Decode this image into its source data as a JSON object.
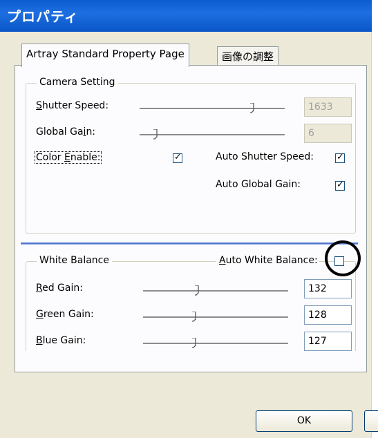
{
  "window": {
    "title": "プロパティ"
  },
  "tabs": [
    {
      "label": "Artray Standard Property Page",
      "active": true
    },
    {
      "label": "画像の調整",
      "active": false
    }
  ],
  "camera_setting": {
    "legend": "Camera Setting",
    "shutter_speed": {
      "label_ul": "S",
      "label_rest": "hutter Speed:",
      "value": "1633",
      "slider_fraction": 0.79
    },
    "global_gain": {
      "label_pre": "Global Ga",
      "label_ul": "i",
      "label_post": "n:",
      "value": "6",
      "slider_fraction": 0.1
    },
    "color_enable": {
      "label_pre": "Color ",
      "label_ul": "E",
      "label_post": "nable:",
      "checked": true
    },
    "auto_shutter_speed": {
      "label": "Auto Shutter Speed:",
      "checked": true
    },
    "auto_global_gain": {
      "label": "Auto Global Gain:",
      "checked": true
    }
  },
  "white_balance": {
    "legend": "White Balance",
    "auto": {
      "label_ul": "A",
      "label_rest": "uto White Balance:",
      "checked": false
    },
    "red_gain": {
      "label_ul": "R",
      "label_rest": "ed Gain:",
      "value": "132",
      "slider_fraction": 0.37
    },
    "green_gain": {
      "label_ul": "G",
      "label_rest": "reen Gain:",
      "value": "128",
      "slider_fraction": 0.35
    },
    "blue_gain": {
      "label_ul": "B",
      "label_rest": "lue Gain:",
      "value": "127",
      "slider_fraction": 0.35
    }
  },
  "buttons": {
    "ok": "OK"
  },
  "colors": {
    "titlebar": "#0a5cd0",
    "dialog_bg": "#ece9d8",
    "panel_bg": "#fcfcfe",
    "annotation_circle": "#000000"
  }
}
